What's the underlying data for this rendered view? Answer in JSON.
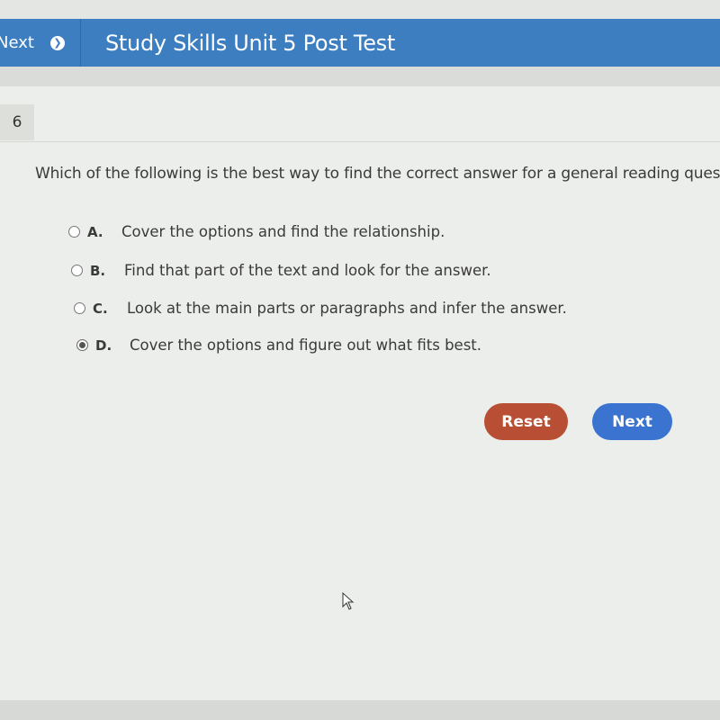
{
  "header": {
    "nav_label": "Next",
    "nav_icon": "arrow-right-circle-icon",
    "title": "Study Skills Unit 5 Post Test"
  },
  "question": {
    "number": "6",
    "text": "Which of the following is the best way to find the correct answer for a general reading question?"
  },
  "options": [
    {
      "letter": "A.",
      "text": "Cover the options and find the relationship.",
      "selected": false
    },
    {
      "letter": "B.",
      "text": "Find that part of the text and look for the answer.",
      "selected": false
    },
    {
      "letter": "C.",
      "text": "Look at the main parts or paragraphs and infer the answer.",
      "selected": false
    },
    {
      "letter": "D.",
      "text": "Cover the options and figure out what fits best.",
      "selected": true
    }
  ],
  "buttons": {
    "reset_label": "Reset",
    "next_label": "Next"
  },
  "colors": {
    "header": "#3c7ec0",
    "reset": "#b84f34",
    "next": "#3b74d0"
  }
}
